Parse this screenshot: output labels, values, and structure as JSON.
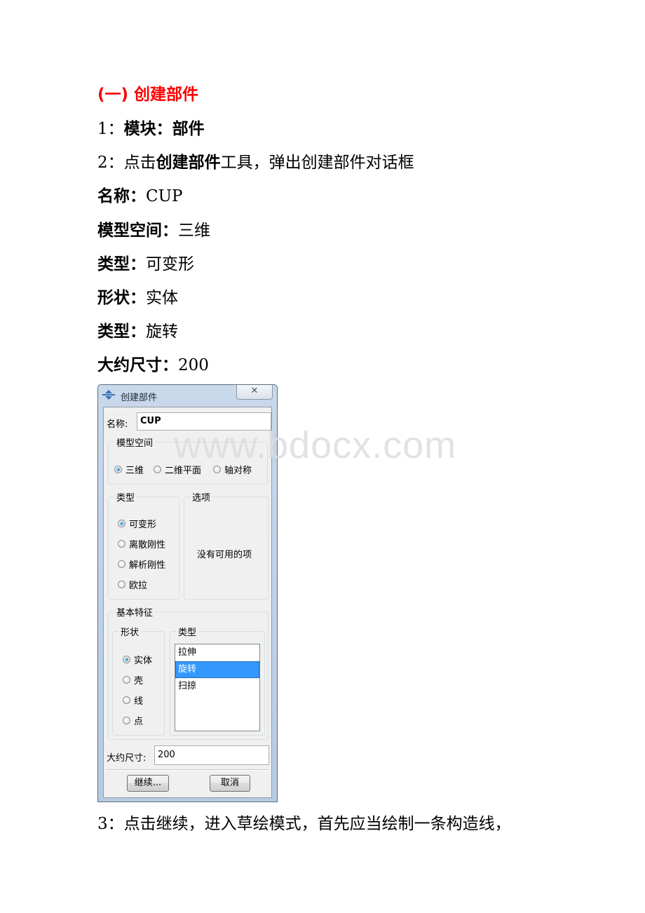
{
  "doc": {
    "heading": "(一) 创建部件",
    "step1": {
      "num": "1：",
      "label": "模块：部件"
    },
    "step2": {
      "num": "2：",
      "pre": "点击",
      "bold": "创建部件",
      "post": "工具，弹出创建部件对话框"
    },
    "fields": [
      {
        "label": "名称：",
        "value": "CUP"
      },
      {
        "label": "模型空间：",
        "value": "三维"
      },
      {
        "label": "类型：",
        "value": "可变形"
      },
      {
        "label": "形状：",
        "value": "实体"
      },
      {
        "label": "类型：",
        "value": "旋转"
      },
      {
        "label": "大约尺寸：",
        "value": "200"
      }
    ],
    "step3": "3：点击继续，进入草绘模式，首先应当绘制一条构造线，"
  },
  "watermark": "www.bdocx.com",
  "dialog": {
    "title": "创建部件",
    "close_glyph": "✕",
    "name_label": "名称:",
    "name_value": "CUP",
    "model_space": {
      "legend": "模型空间",
      "options": [
        "三维",
        "二维平面",
        "轴对称"
      ],
      "selected": "三维"
    },
    "type": {
      "legend": "类型",
      "options": [
        "可变形",
        "离散刚性",
        "解析刚性",
        "欧拉"
      ],
      "selected": "可变形"
    },
    "options_group": {
      "legend": "选项",
      "empty_text": "没有可用的项"
    },
    "base_feature": {
      "legend": "基本特征",
      "shape": {
        "legend": "形状",
        "options": [
          "实体",
          "壳",
          "线",
          "点"
        ],
        "selected": "实体"
      },
      "type": {
        "legend": "类型",
        "items": [
          "拉伸",
          "旋转",
          "扫掠"
        ],
        "selected": "旋转"
      }
    },
    "approx_size_label": "大约尺寸:",
    "approx_size_value": "200",
    "continue_label": "继续...",
    "cancel_label": "取消"
  }
}
